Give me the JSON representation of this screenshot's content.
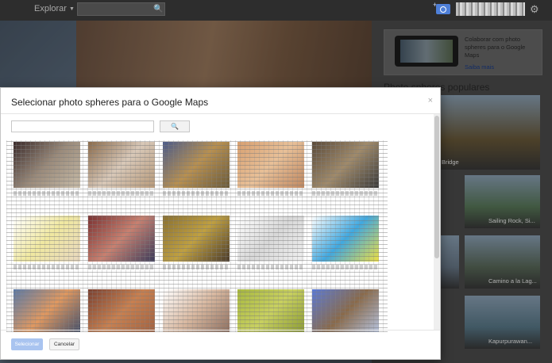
{
  "topbar": {
    "explore_label": "Explorar",
    "search_value": "",
    "icons": [
      "search-icon",
      "camera-add-icon",
      "gear-icon"
    ]
  },
  "right_panel": {
    "promo_text": "Colaborar com photo spheres para o Google Maps",
    "promo_link": "Saiba mais",
    "popular_title": "Photo spheres populares",
    "thumbs": [
      {
        "caption": "Bridge",
        "color": "#6a5a3a"
      },
      {
        "caption": "",
        "color": "#4a6a7a"
      },
      {
        "caption": "Sailing Rock, Si...",
        "color": "#5a7a5a"
      },
      {
        "caption": "",
        "color": "#4a5a7a"
      },
      {
        "caption": "",
        "color": "#6a7a8a"
      },
      {
        "caption": "Camino a la Lag...",
        "color": "#5a6a5a"
      },
      {
        "caption": "",
        "color": "#5a6a7a"
      },
      {
        "caption": "Kapurpurawan...",
        "color": "#5a7a8a"
      }
    ]
  },
  "dialog": {
    "title": "Selecionar photo spheres para o Google Maps",
    "close_glyph": "×",
    "search_placeholder": "",
    "search_btn_glyph": "🔍",
    "select_label": "Selecionar",
    "cancel_label": "Cancelar",
    "photos": [
      {
        "colors": [
          "#3a2a2a",
          "#9a8a7a",
          "#c8bca8"
        ]
      },
      {
        "colors": [
          "#8a6a4a",
          "#d8c8b8",
          "#b89a7a"
        ]
      },
      {
        "colors": [
          "#4a5a8a",
          "#b89050",
          "#6a5a3a"
        ]
      },
      {
        "colors": [
          "#d8a070",
          "#e8c098",
          "#c08860"
        ]
      },
      {
        "colors": [
          "#5a4a3a",
          "#a08a6a",
          "#3a3a3a"
        ]
      },
      {
        "colors": [
          "#ffffff",
          "#f0e8a0",
          "#e8d8c0"
        ]
      },
      {
        "colors": [
          "#7a3030",
          "#c88070",
          "#3a3a5a"
        ]
      },
      {
        "colors": [
          "#8a7030",
          "#c0a040",
          "#4a3a2a"
        ]
      },
      {
        "colors": [
          "#ffffff",
          "#d8d8d8",
          "#f0f0f0"
        ]
      },
      {
        "colors": [
          "#ffffff",
          "#40a8e0",
          "#f0e040"
        ]
      },
      {
        "colors": [
          "#5a7aa8",
          "#e09860",
          "#3a4a6a"
        ]
      },
      {
        "colors": [
          "#7a4030",
          "#c88050",
          "#a06040"
        ]
      },
      {
        "colors": [
          "#ffffff",
          "#d8b8a0",
          "#8a6a5a"
        ]
      },
      {
        "colors": [
          "#a8b840",
          "#c8d060",
          "#8a9a30"
        ]
      },
      {
        "colors": [
          "#5a7ad8",
          "#8a6a4a",
          "#b8c8e8"
        ]
      }
    ]
  }
}
